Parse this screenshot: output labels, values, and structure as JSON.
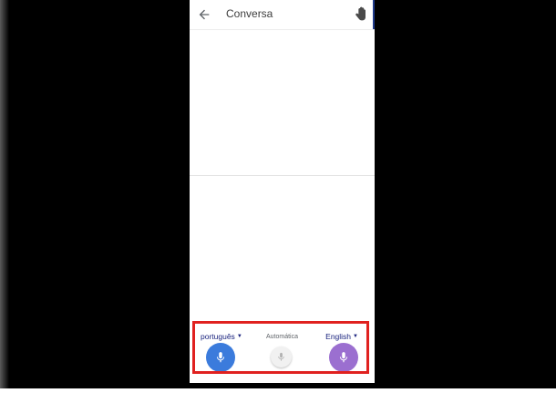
{
  "header": {
    "title": "Conversa",
    "back_icon": "arrow-left-icon",
    "hand_icon": "hand-icon"
  },
  "languages": {
    "left": "português",
    "right": "English",
    "auto_label": "Automática"
  },
  "colors": {
    "left_mic": "#3b7bdc",
    "right_mic": "#9b6fd0",
    "auto_mic": "#f1f1f1",
    "highlight": "#e0211f",
    "lang_text": "#1a237e"
  }
}
